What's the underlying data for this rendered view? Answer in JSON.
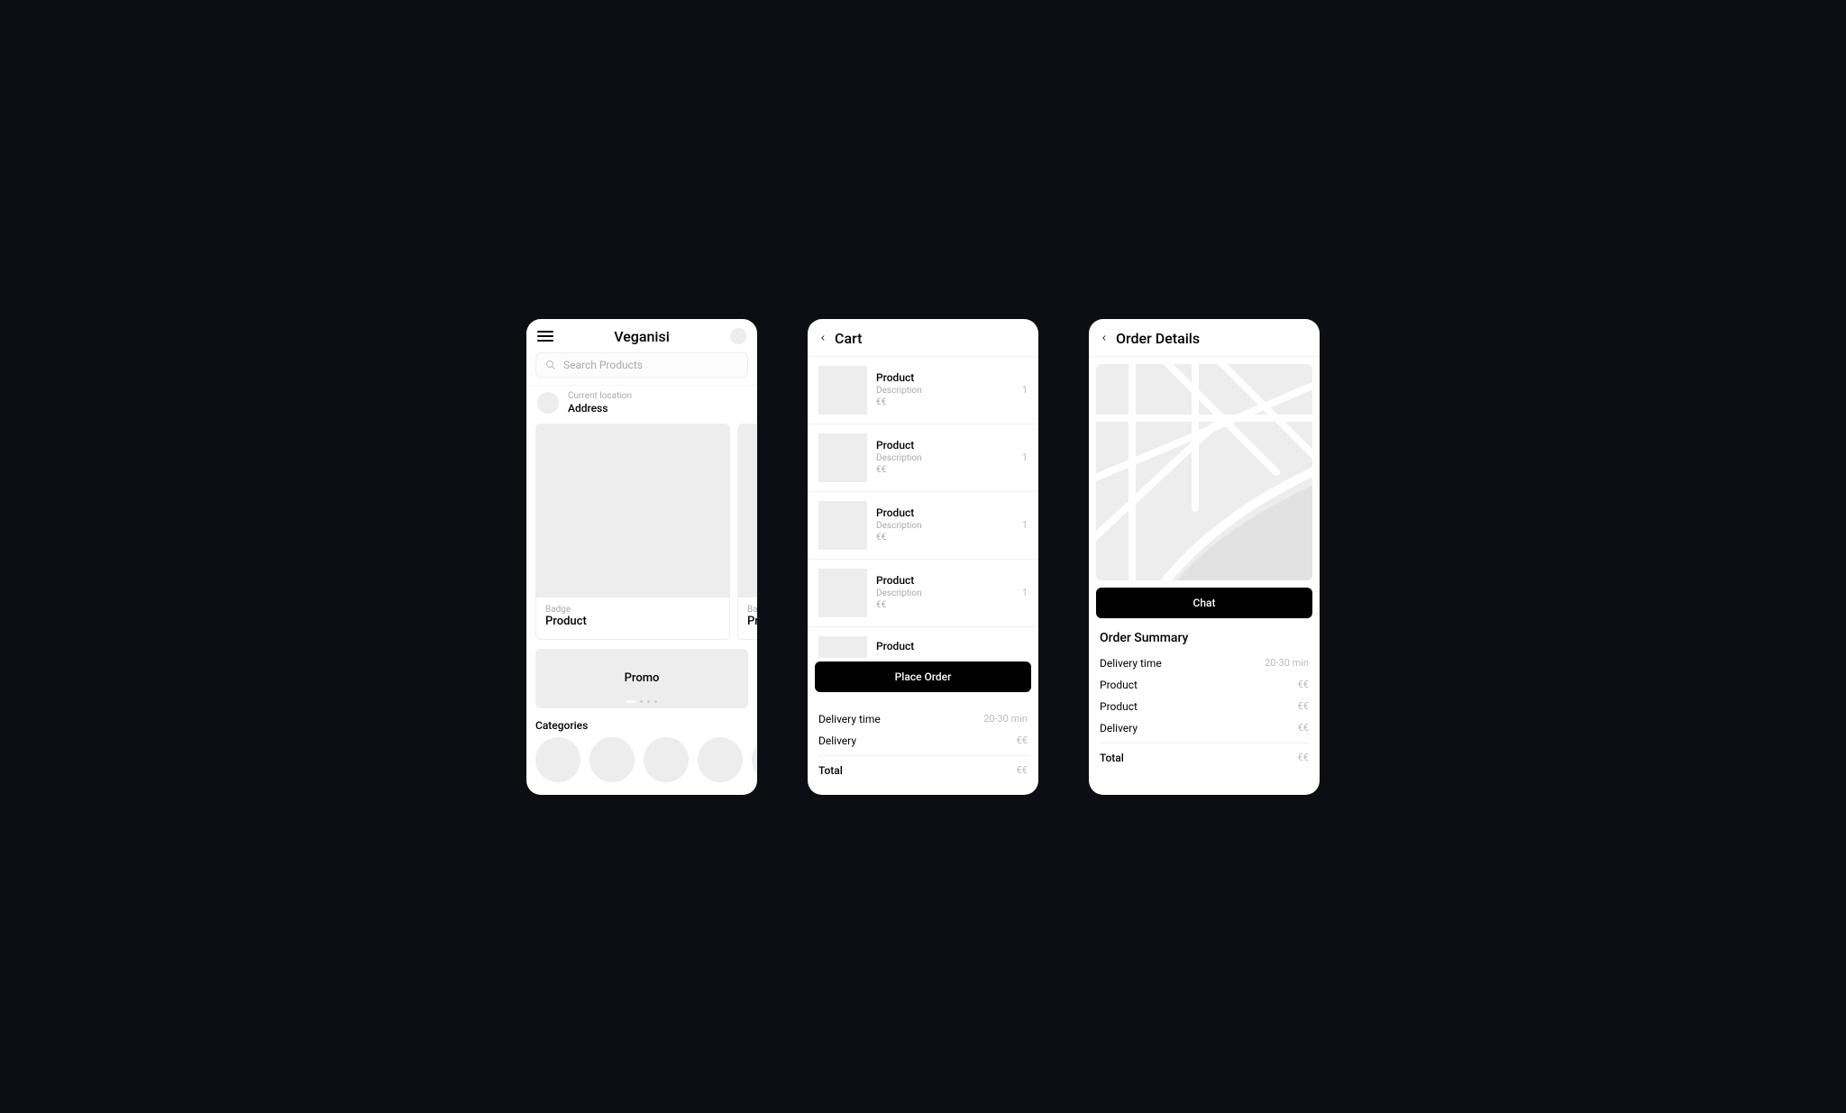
{
  "screen1": {
    "title": "Veganisi",
    "search_placeholder": "Search Products",
    "location_label": "Current location",
    "location_address": "Address",
    "cards": [
      {
        "badge": "Badge",
        "name": "Product"
      },
      {
        "badge": "Badge",
        "name": "Product"
      }
    ],
    "promo_label": "Promo",
    "categories_title": "Categories"
  },
  "screen2": {
    "title": "Cart",
    "items": [
      {
        "name": "Product",
        "desc": "Description",
        "price": "€€",
        "qty": "1"
      },
      {
        "name": "Product",
        "desc": "Description",
        "price": "€€",
        "qty": "1"
      },
      {
        "name": "Product",
        "desc": "Description",
        "price": "€€",
        "qty": "1"
      },
      {
        "name": "Product",
        "desc": "Description",
        "price": "€€",
        "qty": "1"
      },
      {
        "name": "Product"
      }
    ],
    "cta": "Place Order",
    "summary": {
      "delivery_time_k": "Delivery time",
      "delivery_time_v": "20-30 min",
      "delivery_k": "Delivery",
      "delivery_v": "€€",
      "total_k": "Total",
      "total_v": "€€"
    }
  },
  "screen3": {
    "title": "Order Details",
    "cta": "Chat",
    "summary_title": "Order Summary",
    "summary": {
      "delivery_time_k": "Delivery time",
      "delivery_time_v": "20-30 min",
      "product1_k": "Product",
      "product1_v": "€€",
      "product2_k": "Product",
      "product2_v": "€€",
      "delivery_k": "Delivery",
      "delivery_v": "€€",
      "total_k": "Total",
      "total_v": "€€"
    }
  }
}
